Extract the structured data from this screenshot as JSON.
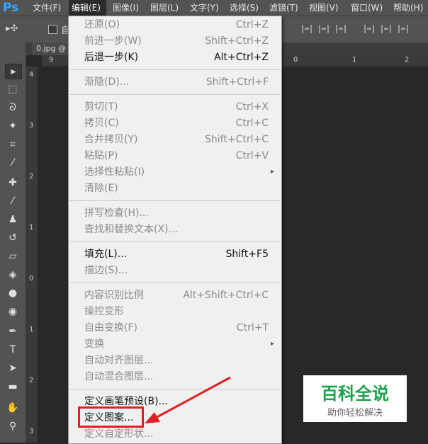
{
  "app": {
    "logo": "Ps"
  },
  "menubar": {
    "items": [
      {
        "label": "文件(F)"
      },
      {
        "label": "编辑(E)"
      },
      {
        "label": "图像(I)"
      },
      {
        "label": "图层(L)"
      },
      {
        "label": "文字(Y)"
      },
      {
        "label": "选择(S)"
      },
      {
        "label": "滤镜(T)"
      },
      {
        "label": "视图(V)"
      },
      {
        "label": "窗口(W)"
      },
      {
        "label": "帮助(H)"
      }
    ]
  },
  "options_bar": {
    "move_symbol": "▸✣",
    "auto_label": "自"
  },
  "document": {
    "tab_label": "0.jpg @"
  },
  "rulers": {
    "horizontal": [
      "9",
      "0",
      "1",
      "2"
    ],
    "vertical": [
      "4",
      "3",
      "2",
      "1",
      "0",
      "1",
      "2",
      "3"
    ]
  },
  "edit_menu": {
    "items": [
      {
        "label": "还原(O)",
        "shortcut": "Ctrl+Z",
        "enabled": false
      },
      {
        "label": "前进一步(W)",
        "shortcut": "Shift+Ctrl+Z",
        "enabled": false
      },
      {
        "label": "后退一步(K)",
        "shortcut": "Alt+Ctrl+Z",
        "enabled": true
      },
      {
        "label": "渐隐(D)...",
        "shortcut": "Shift+Ctrl+F",
        "enabled": false
      },
      {
        "label": "剪切(T)",
        "shortcut": "Ctrl+X",
        "enabled": false
      },
      {
        "label": "拷贝(C)",
        "shortcut": "Ctrl+C",
        "enabled": false
      },
      {
        "label": "合并拷贝(Y)",
        "shortcut": "Shift+Ctrl+C",
        "enabled": false
      },
      {
        "label": "粘贴(P)",
        "shortcut": "Ctrl+V",
        "enabled": false
      },
      {
        "label": "选择性粘贴(I)",
        "shortcut": "",
        "enabled": false,
        "submenu": true
      },
      {
        "label": "清除(E)",
        "shortcut": "",
        "enabled": false
      },
      {
        "label": "拼写检查(H)...",
        "shortcut": "",
        "enabled": false
      },
      {
        "label": "查找和替换文本(X)...",
        "shortcut": "",
        "enabled": false
      },
      {
        "label": "填充(L)...",
        "shortcut": "Shift+F5",
        "enabled": true
      },
      {
        "label": "描边(S)...",
        "shortcut": "",
        "enabled": false
      },
      {
        "label": "内容识别比例",
        "shortcut": "Alt+Shift+Ctrl+C",
        "enabled": false
      },
      {
        "label": "操控变形",
        "shortcut": "",
        "enabled": false
      },
      {
        "label": "自由变换(F)",
        "shortcut": "Ctrl+T",
        "enabled": false
      },
      {
        "label": "变换",
        "shortcut": "",
        "enabled": false,
        "submenu": true
      },
      {
        "label": "自动对齐图层...",
        "shortcut": "",
        "enabled": false
      },
      {
        "label": "自动混合图层...",
        "shortcut": "",
        "enabled": false
      },
      {
        "label": "定义画笔预设(B)...",
        "shortcut": "",
        "enabled": true
      },
      {
        "label": "定义图案...",
        "shortcut": "",
        "enabled": true
      },
      {
        "label": "定义自定形状...",
        "shortcut": "",
        "enabled": false
      }
    ],
    "submenu_arrow": "▸"
  },
  "watermark": {
    "title": "百科全说",
    "subtitle": "助你轻松解决"
  },
  "colors": {
    "highlight": "#e02020",
    "watermark_green": "#1aa34a"
  }
}
